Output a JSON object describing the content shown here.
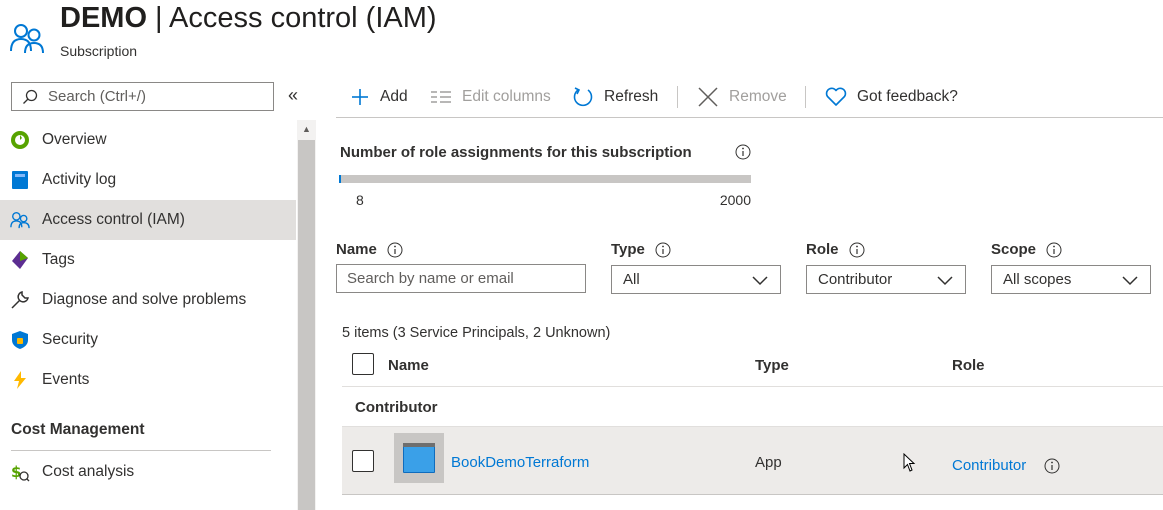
{
  "header": {
    "title_bold": "DEMO",
    "title_rest": " | Access control (IAM)",
    "subtitle": "Subscription",
    "icon": "users-icon"
  },
  "sidebar": {
    "search_placeholder": "Search (Ctrl+/)",
    "collapse_glyph": "«",
    "items": [
      {
        "label": "Overview",
        "icon": "overview-icon"
      },
      {
        "label": "Activity log",
        "icon": "activity-log-icon"
      },
      {
        "label": "Access control (IAM)",
        "icon": "users-icon",
        "active": true
      },
      {
        "label": "Tags",
        "icon": "tag-icon"
      },
      {
        "label": "Diagnose and solve problems",
        "icon": "wrench-icon"
      },
      {
        "label": "Security",
        "icon": "shield-icon"
      },
      {
        "label": "Events",
        "icon": "lightning-icon"
      }
    ],
    "section_title": "Cost Management",
    "section_items": [
      {
        "label": "Cost analysis",
        "icon": "cost-analysis-icon"
      }
    ]
  },
  "toolbar": {
    "add": "Add",
    "edit_columns": "Edit columns",
    "refresh": "Refresh",
    "remove": "Remove",
    "feedback": "Got feedback?"
  },
  "assignments": {
    "title": "Number of role assignments for this subscription",
    "current": "8",
    "max": "2000",
    "fill_fraction": 0.004
  },
  "filters": {
    "name_label": "Name",
    "name_placeholder": "Search by name or email",
    "type_label": "Type",
    "type_value": "All",
    "role_label": "Role",
    "role_value": "Contributor",
    "scope_label": "Scope",
    "scope_value": "All scopes"
  },
  "results": {
    "count_text": "5 items (3 Service Principals, 2 Unknown)",
    "columns": {
      "name": "Name",
      "type": "Type",
      "role": "Role"
    },
    "group": "Contributor",
    "rows": [
      {
        "name": "BookDemoTerraform",
        "type": "App",
        "role": "Contributor"
      }
    ]
  },
  "colors": {
    "accent": "#0078d4",
    "selected_nav": "#e1dfdd",
    "row_highlight": "#edebe9"
  }
}
